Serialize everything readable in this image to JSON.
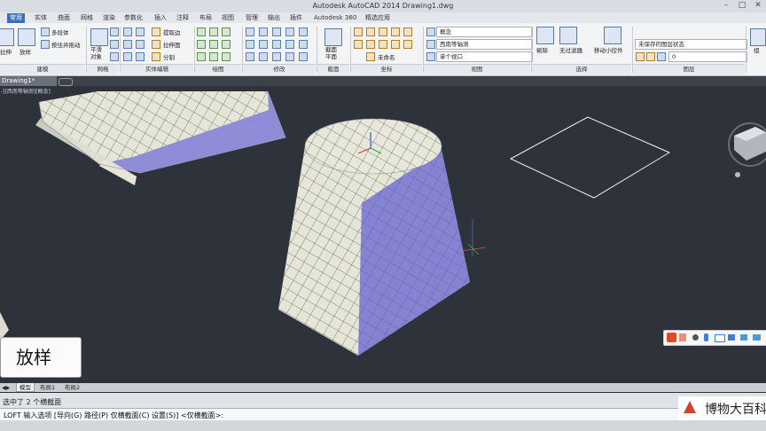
{
  "window": {
    "title": "Autodesk AutoCAD 2014    Drawing1.dwg"
  },
  "ribbon_tabs": [
    "常用",
    "实体",
    "曲面",
    "网格",
    "渲染",
    "参数化",
    "插入",
    "注释",
    "布局",
    "视图",
    "管理",
    "输出",
    "插件",
    "Autodesk 360",
    "精选应用"
  ],
  "ribbon": {
    "modeling": {
      "extrude": "拉伸",
      "loft": "放样",
      "polysolid": "多段体",
      "presspull": "按住并拖动",
      "group": "建模"
    },
    "mesh": {
      "smooth": "平滑\n对象",
      "group": "网格"
    },
    "solid_edit": {
      "extract_edges": "提取边",
      "extrude_faces": "拉伸面",
      "separate": "分割",
      "group": "实体编辑"
    },
    "draw": {
      "group": "绘图"
    },
    "modify": {
      "group": "修改"
    },
    "section": {
      "plane": "截面\n平面",
      "group": "截面"
    },
    "coordinates": {
      "group": "坐标"
    },
    "view": {
      "visual_style": "概念",
      "view_preset": "西南等轴测",
      "unnamed": "未命名",
      "viewport_config": "单个视口",
      "group": "视图"
    },
    "selection": {
      "cull": "剔除",
      "no_filter": "无过滤器",
      "gizmo": "移动小控件",
      "group": "选择"
    },
    "layers": {
      "state": "未保存的图层状态",
      "current": "0",
      "group": "图层"
    },
    "groups": {
      "label": "组"
    }
  },
  "document_tab": "Drawing1*",
  "viewport": {
    "label": "-][西南等轴测][概念]"
  },
  "caption": "放样",
  "layout_tabs": [
    "模型",
    "布局1",
    "布局2"
  ],
  "command_history": "选中了 2 个横截面",
  "command_line": "LOFT 输入选项 [导向(G) 路径(P) 仅横截面(C) 设置(S)] <仅横截面>:",
  "watermark": "博物大百科",
  "colors": {
    "viewport_bg": "#2e323a",
    "ribbon_active_tab": "#3a6fb8",
    "solid_light": "#e6e6d8",
    "solid_dark": "#7b78d4"
  }
}
